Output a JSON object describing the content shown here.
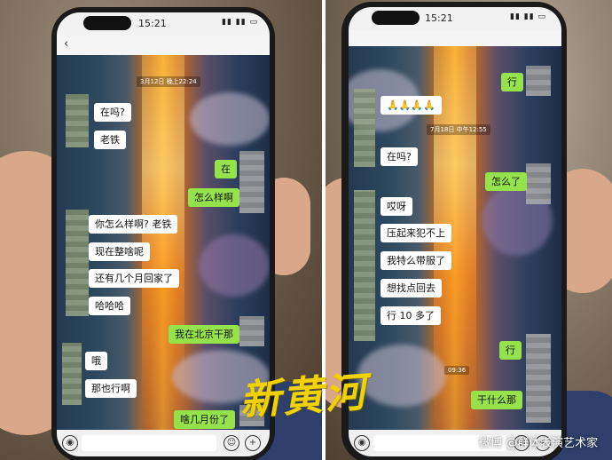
{
  "left_phone": {
    "status_time": "15:21",
    "timestamp": "3月12日 晚上22:24",
    "messages": [
      {
        "side": "in",
        "text": "在吗?"
      },
      {
        "side": "in",
        "text": "老铁"
      },
      {
        "side": "out",
        "text": "在"
      },
      {
        "side": "out",
        "text": "怎么样啊"
      },
      {
        "side": "in",
        "text": "你怎么样啊? 老铁"
      },
      {
        "side": "in",
        "text": "现在整啥呢"
      },
      {
        "side": "in",
        "text": "还有几个月回家了"
      },
      {
        "side": "in",
        "text": "哈哈哈"
      },
      {
        "side": "out",
        "text": "我在北京干那"
      },
      {
        "side": "in",
        "text": "哦"
      },
      {
        "side": "in",
        "text": "那也行啊"
      },
      {
        "side": "out",
        "text": "啥几月份了"
      }
    ]
  },
  "right_phone": {
    "status_time": "15:21",
    "timestamp_top": "7月18日 中午12:55",
    "timestamp_bottom": "09:36",
    "messages": [
      {
        "side": "out",
        "text": "行"
      },
      {
        "side": "in",
        "text": "🙏🙏🙏🙏"
      },
      {
        "side": "in",
        "text": "在吗?"
      },
      {
        "side": "out",
        "text": "怎么了"
      },
      {
        "side": "in",
        "text": "哎呀"
      },
      {
        "side": "in",
        "text": "压起来犯不上"
      },
      {
        "side": "in",
        "text": "我特么带服了"
      },
      {
        "side": "in",
        "text": "想找点回去"
      },
      {
        "side": "in",
        "text": "行 10 多了"
      },
      {
        "side": "out",
        "text": "行"
      },
      {
        "side": "out",
        "text": "干什么那"
      }
    ]
  },
  "watermark": {
    "logo_text": "新黄河",
    "credit": "微博 @群体表演艺术家"
  },
  "colors": {
    "incoming_bubble": "#ffffff",
    "outgoing_bubble": "#95e24b",
    "watermark_yellow": "#f0d200"
  }
}
